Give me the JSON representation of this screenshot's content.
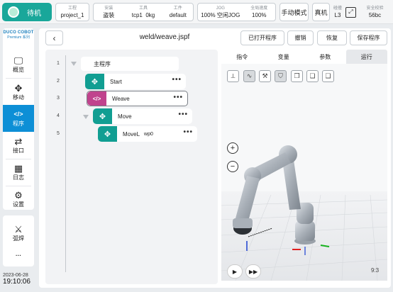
{
  "status": {
    "label": "待机",
    "icon": "status-dot-icon"
  },
  "topbar": {
    "project": {
      "label": "工程",
      "value": "project_1"
    },
    "install": {
      "label": "安装",
      "value": "盗装"
    },
    "tool": {
      "label": "工具",
      "value1": "tcp1",
      "value2": "0kg"
    },
    "workpiece": {
      "label": "工件",
      "value": "default"
    },
    "jog": {
      "label": "JOG",
      "value1": "100%",
      "value2": "空闲JOG"
    },
    "global_speed": {
      "label": "全局速度",
      "value": "100%"
    },
    "manual_mode": "手动模式",
    "real_machine": "真机",
    "collision": {
      "label": "碰撞",
      "value": "L3"
    },
    "safety": {
      "label": "安全校验",
      "value": "56bc"
    }
  },
  "brand": {
    "name": "DUCO COBOT",
    "sub": "Premium 系列"
  },
  "sidebar": {
    "items": [
      {
        "label": "概览",
        "icon": "monitor-icon"
      },
      {
        "label": "移动",
        "icon": "move-icon"
      },
      {
        "label": "程序",
        "icon": "code-icon"
      },
      {
        "label": "接口",
        "icon": "swap-icon"
      },
      {
        "label": "日志",
        "icon": "calendar-icon"
      },
      {
        "label": "设置",
        "icon": "gear-icon"
      }
    ],
    "weld": {
      "label": "弧焊",
      "icon": "welding-torch-icon"
    },
    "more": "···"
  },
  "datetime": {
    "date": "2023-06-28",
    "time": "19:10:06"
  },
  "header": {
    "file_title": "weld/weave.jspf",
    "opened_programs": "已打开程序",
    "undo": "撤销",
    "redo": "恢复",
    "save": "保存程序"
  },
  "tree": {
    "root": {
      "line": "1",
      "label": "主程序"
    },
    "nodes": [
      {
        "line": "2",
        "label": "Start",
        "param": "",
        "color": "#119e92",
        "icon": "move-cross-icon"
      },
      {
        "line": "3",
        "label": "Weave",
        "param": "",
        "color": "#c0438d",
        "icon": "code-icon"
      },
      {
        "line": "4",
        "label": "Move",
        "param": "",
        "color": "#119e92",
        "icon": "move-cross-icon"
      },
      {
        "line": "5",
        "label": "MoveL",
        "param": "wp0",
        "color": "#119e92",
        "icon": "move-cross-icon"
      }
    ],
    "menu": "•••"
  },
  "right_tabs": [
    "指令",
    "变量",
    "参数",
    "运行"
  ],
  "view_tools": [
    "view-iso-icon",
    "path-icon",
    "tcp-icon",
    "shield-icon",
    "cube-front-icon",
    "cube-top-icon",
    "cube-side-icon"
  ],
  "viewer": {
    "zoom_in": "+",
    "zoom_out": "−",
    "play": "▶",
    "fast": "▶▶",
    "ratio": "9:3"
  }
}
